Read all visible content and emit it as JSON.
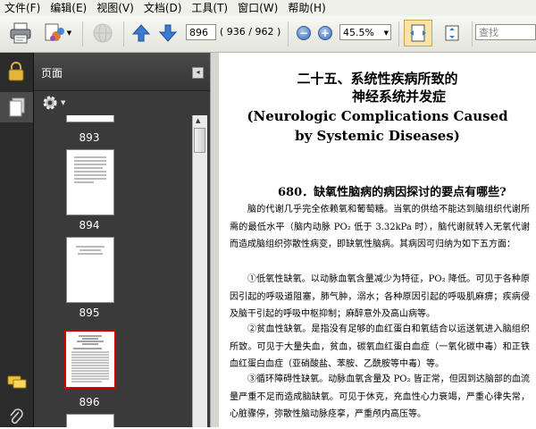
{
  "menu": [
    "文件(F)",
    "编辑(E)",
    "视图(V)",
    "文档(D)",
    "工具(T)",
    "窗口(W)",
    "帮助(H)"
  ],
  "toolbar": {
    "page_number": "896",
    "page_count": "( 936 / 962 )",
    "zoom": "45.5%",
    "search_placeholder": "查找"
  },
  "panel": {
    "title": "页面",
    "thumbnails": [
      {
        "label": "893"
      },
      {
        "label": "894"
      },
      {
        "label": "895"
      },
      {
        "label": "896",
        "selected": true
      }
    ]
  },
  "document": {
    "title_cn_1": "二十五、系统性疾病所致的",
    "title_cn_2": "神经系统并发症",
    "title_en_1": "(Neurologic Complications Caused",
    "title_en_2": "by Systemic Diseases)",
    "question": "680．缺氧性脑病的病因探讨的要点有哪些?",
    "paragraphs": [
      "脑的代谢几乎完全依赖氧和葡萄糖。当氧的供给不能达到脑组织代谢所需的最低水平（脑内动脉 PO₂ 低于 3.32kPa 时），脑代谢就转入无氧代谢而造成脑组织弥散性病变，即缺氧性脑病。其病因可归纳为如下五方面：",
      "①低氧性缺氧。以动脉血氧含量减少为特征，PO₂ 降低。可见于各种原因引起的呼吸道阻塞，肺气肿，溺水；各种原因引起的呼吸肌麻痹；疾病侵及脑干引起的呼吸中枢抑制；麻醉意外及高山病等。",
      "②贫血性缺氧。是指没有足够的血红蛋白和氧结合以运送氧进入脑组织所致。可见于大量失血，贫血，碳氧血红蛋白血症（一氧化碳中毒）和正铁血红蛋白血症（亚硝酸盐、苯胺、乙酰胺等中毒）等。",
      "③循环障碍性缺氧。动脉血氧含量及 PO₂ 皆正常，但因到达脑部的血流量严重不足而造成脑缺氧。可见于休克，充血性心力衰竭，严重心律失常，心脏骤停，弥散性脑动脉痉挛，严重颅内高压等。"
    ]
  },
  "colors": {
    "panel_bg": "#3a3a3a",
    "strip_bg": "#2b2b2b",
    "selection": "#d40000",
    "menubar_bg": "#f0f0ea"
  }
}
